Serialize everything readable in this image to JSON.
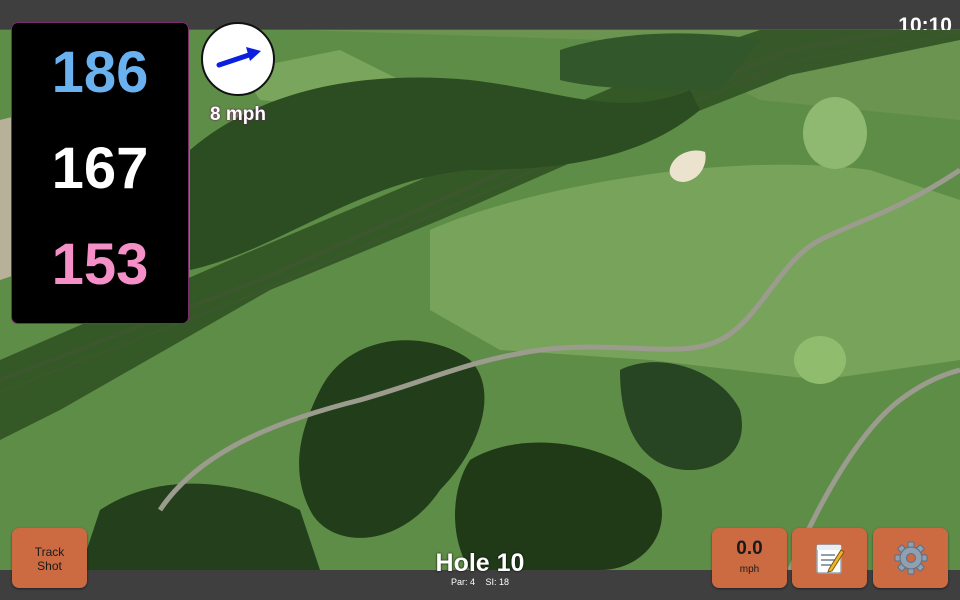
{
  "status_bar": {
    "time": "10:10"
  },
  "distances": {
    "back": "186",
    "middle": "167",
    "front": "153"
  },
  "wind": {
    "speed": "8 mph",
    "arrow_icon": "wind-arrow-icon",
    "arrow_color": "#0a1fe0"
  },
  "hole": {
    "title": "Hole 10",
    "par": "Par: 4",
    "stroke_index": "SI: 18"
  },
  "buttons": {
    "track_shot_line1": "Track",
    "track_shot_line2": "Shot",
    "speed_value": "0.0",
    "speed_unit": "mph",
    "notes_icon": "notepad-icon",
    "settings_icon": "gear-icon"
  },
  "colors": {
    "button_bg": "#cc6a42",
    "back_yardage": "#6ab1ef",
    "middle_yardage": "#ffffff",
    "front_yardage": "#f48fc8",
    "panel_border": "#7a2c6c"
  }
}
